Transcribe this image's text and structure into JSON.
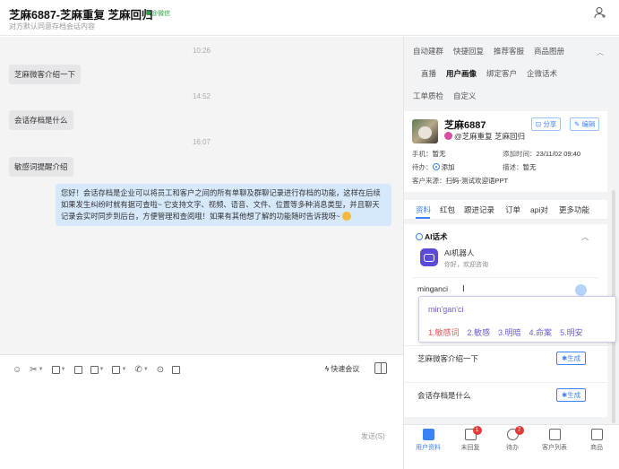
{
  "header": {
    "title": "芝麻6887-芝麻重复 芝麻回归",
    "tag": "@微信",
    "subtitle": "对方默认同意存档会话内容"
  },
  "chat": {
    "messages": [
      {
        "time": "10:26",
        "text": "芝麻微客介绍一下"
      },
      {
        "time": "14:52",
        "text": "会话存档是什么"
      },
      {
        "time": "16:07",
        "text": "敏感词提醒介绍"
      }
    ],
    "reply": "您好！会话存档是企业可以将员工和客户之间的所有单聊及群聊记录进行存档的功能，这样在后续如果发生纠纷时就有据可查啦~ 它支持文字、视频、语音、文件、位置等多种消息类型，并且聊天记录会实时同步到后台，方便管理和查阅哦！如果有其他想了解的功能随时告诉我呀~"
  },
  "composer": {
    "quick_label": "快速会议",
    "send_label": "发送(S)"
  },
  "right_panel": {
    "tabs_row1": [
      "自动建群",
      "快捷回复",
      "推荐客服",
      "商品图册"
    ],
    "tabs_row2": [
      "直播",
      "用户画像",
      "绑定客户",
      "企微话术"
    ],
    "tabs_row3": [
      "工单质检",
      "自定义"
    ],
    "active_tab": "用户画像"
  },
  "customer": {
    "name": "芝麻6887",
    "tag": "@芝麻重复 芝麻回归",
    "share_label": "分享",
    "edit_label": "编辑",
    "phone_label": "手机：",
    "phone_value": "暂无",
    "added_label": "添加时间：",
    "added_value": "23/11/02 09:40",
    "todo_label": "待办：",
    "todo_value": "添加",
    "desc_label": "描述：",
    "desc_value": "暂无",
    "source_label": "客户来源：",
    "source_value": "扫码-测试欢迎语PPT"
  },
  "detail_tabs": [
    "资料",
    "红包",
    "跟进记录",
    "订单",
    "api对",
    "更多功能"
  ],
  "ai": {
    "title": "AI话术",
    "bot_name": "AI机器人",
    "bot_greeting": "你好，欢迎咨询",
    "input_value": "minganci",
    "suggestions": [
      {
        "text": "芝麻微客介绍一下",
        "action": "生成"
      },
      {
        "text": "会话存档是什么",
        "action": "生成"
      }
    ]
  },
  "ime": {
    "pinyin": "min'gan'ci",
    "candidates": [
      "1.敏感词",
      "2.敏感",
      "3.明暗",
      "4.命案",
      "5.明安"
    ]
  },
  "bottom_nav": [
    {
      "label": "用户资料",
      "badge": ""
    },
    {
      "label": "未回复",
      "badge": "1"
    },
    {
      "label": "待办",
      "badge": "7"
    },
    {
      "label": "客户列表",
      "badge": ""
    },
    {
      "label": "商品",
      "badge": ""
    }
  ]
}
